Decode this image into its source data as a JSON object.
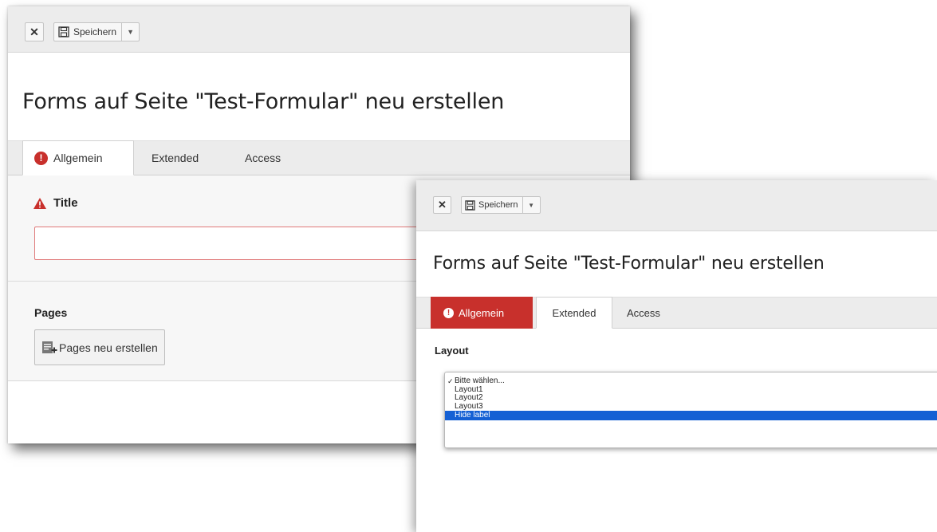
{
  "colors": {
    "error_red": "#c8302c",
    "highlight_blue": "#1560d4",
    "toolbar_bg": "#ececec"
  },
  "window_back": {
    "toolbar": {
      "close_icon": "close-x-icon",
      "save_icon": "floppy-disk-icon",
      "save_label": "Speichern",
      "caret_icon": "caret-down-icon"
    },
    "page_title": "Forms auf Seite \"Test-Formular\" neu erstellen",
    "tabs": [
      {
        "label": "Allgemein",
        "icon": "exclamation-circle-icon",
        "state": "active-error"
      },
      {
        "label": "Extended"
      },
      {
        "label": "Access"
      }
    ],
    "title_field": {
      "label": "Title",
      "icon": "warning-triangle-icon",
      "value": ""
    },
    "pages_field": {
      "label": "Pages",
      "button_label": "Pages neu erstellen",
      "button_icon": "new-record-icon"
    }
  },
  "window_front": {
    "toolbar": {
      "close_icon": "close-x-icon",
      "save_icon": "floppy-disk-icon",
      "save_label": "Speichern",
      "caret_icon": "caret-down-icon"
    },
    "page_title": "Forms auf Seite \"Test-Formular\" neu erstellen",
    "tabs": [
      {
        "label": "Allgemein",
        "icon": "exclamation-circle-icon",
        "state": "error"
      },
      {
        "label": "Extended",
        "state": "active"
      },
      {
        "label": "Access"
      }
    ],
    "layout_field": {
      "label": "Layout",
      "options": [
        {
          "label": "Bitte wählen...",
          "checked": true
        },
        {
          "label": "Layout1"
        },
        {
          "label": "Layout2"
        },
        {
          "label": "Layout3"
        },
        {
          "label": "Hide label",
          "highlighted": true
        }
      ]
    }
  }
}
